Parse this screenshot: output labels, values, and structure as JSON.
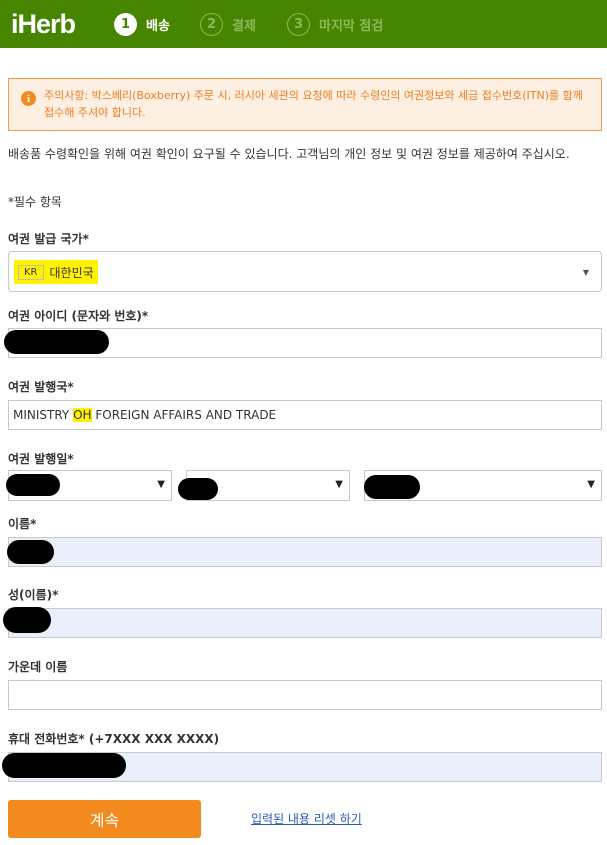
{
  "header": {
    "logo": "iHerb",
    "steps": [
      {
        "num": "1",
        "label": "배송"
      },
      {
        "num": "2",
        "label": "결제"
      },
      {
        "num": "3",
        "label": "마지막 점검"
      }
    ],
    "color": "#458500"
  },
  "notice": {
    "icon": "info-icon",
    "text": "주의사항: 박스베리(Boxberry) 주문 시, 러시아 세관의 요청에 따라 수령인의 여권정보와 세금 접수번호(ITN)를 함께 접수해 주셔야 합니다."
  },
  "intro": "배송품 수령확인을 위해 여권 확인이 요구될 수 있습니다. 고객님의 개인 정보 및 여권 정보를 제공하여 주십시오.",
  "required_note": "*필수 항목",
  "form": {
    "country_label": "여권 발급 국가*",
    "country_code": "KR",
    "country_name": "대한민국",
    "passport_id_label": "여권 아이디 (문자와 번호)*",
    "issuer_label": "여권 발행국*",
    "issuer_value_a": "MINISTRY ",
    "issuer_value_b": "OH",
    "issuer_value_c": " FOREIGN AFFAIRS AND TRADE",
    "issue_date_label": "여권 발행일*",
    "first_name_label": "이름*",
    "last_name_label": "성(이름)*",
    "middle_name_label": "가운데 이름",
    "phone_label": "휴대 전화번호* (+7XXX XXX XXXX)"
  },
  "actions": {
    "continue_label": "계속",
    "reset_label": "입력된 내용 리셋 하기"
  }
}
